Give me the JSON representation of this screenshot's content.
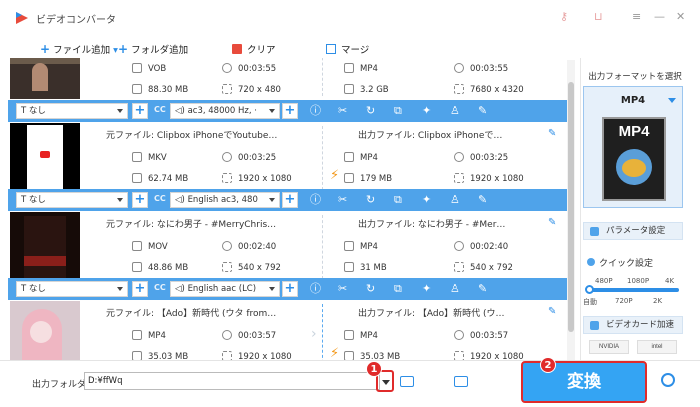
{
  "app": {
    "title": "ビデオコンバータ"
  },
  "toolbar": {
    "add_file": "ファイル追加",
    "add_folder": "フォルダ追加",
    "clear": "クリア",
    "merge": "マージ"
  },
  "files": [
    {
      "source_title": "",
      "output_title": "",
      "src_format": "VOB",
      "src_duration": "00:03:55",
      "src_size": "88.30 MB",
      "src_resolution": "720 x 480",
      "out_format": "MP4",
      "out_duration": "00:03:55",
      "out_size": "3.2 GB",
      "out_resolution": "7680 x 4320",
      "subtitle": "なし",
      "audio": "ac3, 48000 Hz, ·"
    },
    {
      "source_title": "元ファイル: Clipbox iPhoneでYoutube…",
      "output_title": "出力ファイル: Clipbox iPhoneで…",
      "src_format": "MKV",
      "src_duration": "00:03:25",
      "src_size": "62.74 MB",
      "src_resolution": "1920 x 1080",
      "out_format": "MP4",
      "out_duration": "00:03:25",
      "out_size": "179 MB",
      "out_resolution": "1920 x 1080",
      "subtitle": "なし",
      "audio": "English ac3, 480"
    },
    {
      "source_title": "元ファイル: なにわ男子 - #MerryChris…",
      "output_title": "出力ファイル: なにわ男子 - #Mer…",
      "src_format": "MOV",
      "src_duration": "00:02:40",
      "src_size": "48.86 MB",
      "src_resolution": "540 x 792",
      "out_format": "MP4",
      "out_duration": "00:02:40",
      "out_size": "31 MB",
      "out_resolution": "540 x 792",
      "subtitle": "なし",
      "audio": "English aac (LC)"
    },
    {
      "source_title": "元ファイル: 【Ado】新時代 (ウタ from…",
      "output_title": "出力ファイル: 【Ado】新時代 (ウ…",
      "src_format": "MP4",
      "src_duration": "00:03:57",
      "src_size": "35.03 MB",
      "src_resolution": "1920 x 1080",
      "out_format": "MP4",
      "out_duration": "00:03:57",
      "out_size": "35.03 MB",
      "out_resolution": "1920 x 1080"
    }
  ],
  "side": {
    "select_label": "出力フォーマットを選択",
    "format": "MP4",
    "art_label": "MP4",
    "param_settings": "パラメータ設定",
    "quick_settings": "クイック設定",
    "slider_top": [
      "480P",
      "1080P",
      "4K"
    ],
    "slider_bottom": [
      "自動",
      "720P",
      "2K"
    ],
    "slider_level": 0,
    "gpu_accel": "ビデオカード加速",
    "gpu_brands": [
      "NVIDIA",
      "intel"
    ]
  },
  "bottom": {
    "output_folder_label": "出力フォルダ:",
    "output_path": "D:¥ffWq",
    "convert_label": "変換",
    "badge1": "1",
    "badge2": "2"
  },
  "colors": {
    "accent": "#4fa3ea",
    "highlight": "#e02b2b",
    "convert": "#34a4f3"
  }
}
